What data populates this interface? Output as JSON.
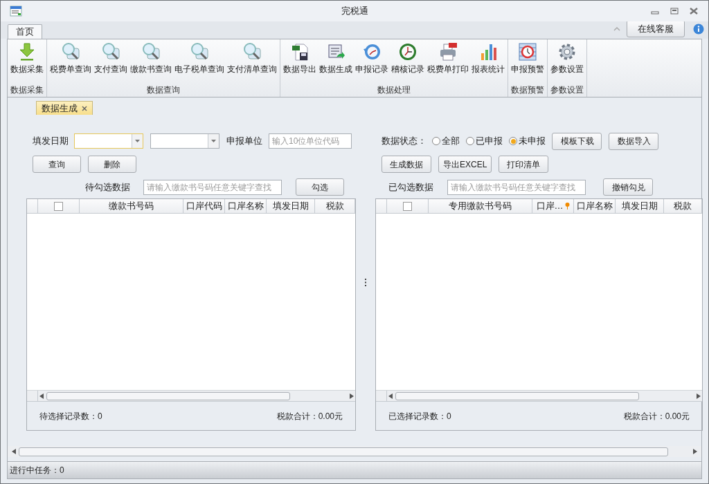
{
  "window": {
    "title": "完税通"
  },
  "tabs": [
    {
      "label": "首页",
      "selected": true
    }
  ],
  "online_service_button": "在线客服",
  "ribbon": {
    "groups": [
      {
        "label": "数据采集",
        "items": [
          {
            "label": "数据采集",
            "kind": "download"
          }
        ]
      },
      {
        "label": "数据查询",
        "items": [
          {
            "label": "税费单查询",
            "kind": "query"
          },
          {
            "label": "支付查询",
            "kind": "query"
          },
          {
            "label": "缴款书查询",
            "kind": "query"
          },
          {
            "label": "电子税单查询",
            "kind": "query"
          },
          {
            "label": "支付清单查询",
            "kind": "query"
          }
        ]
      },
      {
        "label": "数据处理",
        "items": [
          {
            "label": "数据导出",
            "kind": "export"
          },
          {
            "label": "数据生成",
            "kind": "generate"
          },
          {
            "label": "申报记录",
            "kind": "history"
          },
          {
            "label": "稽核记录",
            "kind": "clock"
          },
          {
            "label": "税费单打印",
            "kind": "print"
          },
          {
            "label": "报表统计",
            "kind": "chart"
          }
        ]
      },
      {
        "label": "数据预警",
        "items": [
          {
            "label": "申报预警",
            "kind": "alarm"
          }
        ]
      },
      {
        "label": "参数设置",
        "items": [
          {
            "label": "参数设置",
            "kind": "gear"
          }
        ]
      }
    ]
  },
  "doc_tabs": [
    {
      "label": "数据生成",
      "selected": true
    }
  ],
  "left": {
    "date_label": "填发日期",
    "unit_label": "申报单位",
    "unit_placeholder": "输入10位单位代码",
    "buttons": [
      "查询",
      "删除"
    ],
    "search_label": "待勾选数据",
    "search_placeholder": "请输入缴款书号码任意关键字查找",
    "action_button": "勾选",
    "columns": [
      {
        "label": "缴款书号码",
        "pinned": false
      },
      {
        "label": "口岸代码",
        "pinned": false
      },
      {
        "label": "口岸名称",
        "pinned": false
      },
      {
        "label": "填发日期",
        "pinned": false
      },
      {
        "label": "税款",
        "pinned": false
      }
    ],
    "select_all_checked": false,
    "count": "待选择记录数：0",
    "total": "税款合计：0.00元"
  },
  "right": {
    "status_label": "数据状态：",
    "radios": [
      {
        "label": "全部",
        "selected": false
      },
      {
        "label": "已申报",
        "selected": false
      },
      {
        "label": "未申报",
        "selected": true
      }
    ],
    "top_buttons": [
      "模板下载",
      "数据导入"
    ],
    "buttons": [
      "生成数据",
      "导出EXCEL",
      "打印清单"
    ],
    "search_label": "已勾选数据",
    "search_placeholder": "请输入缴款书号码任意关键字查找",
    "action_button": "撤销勾兑",
    "columns": [
      {
        "label": "专用缴款书号码",
        "pinned": false
      },
      {
        "label": "口岸…",
        "pinned": true
      },
      {
        "label": "口岸名称",
        "pinned": false
      },
      {
        "label": "填发日期",
        "pinned": false
      },
      {
        "label": "税款",
        "pinned": false
      }
    ],
    "select_all_checked": false,
    "count": "已选择记录数：0",
    "total": "税款合计：0.00元"
  },
  "status_bar": "进行中任务：0"
}
